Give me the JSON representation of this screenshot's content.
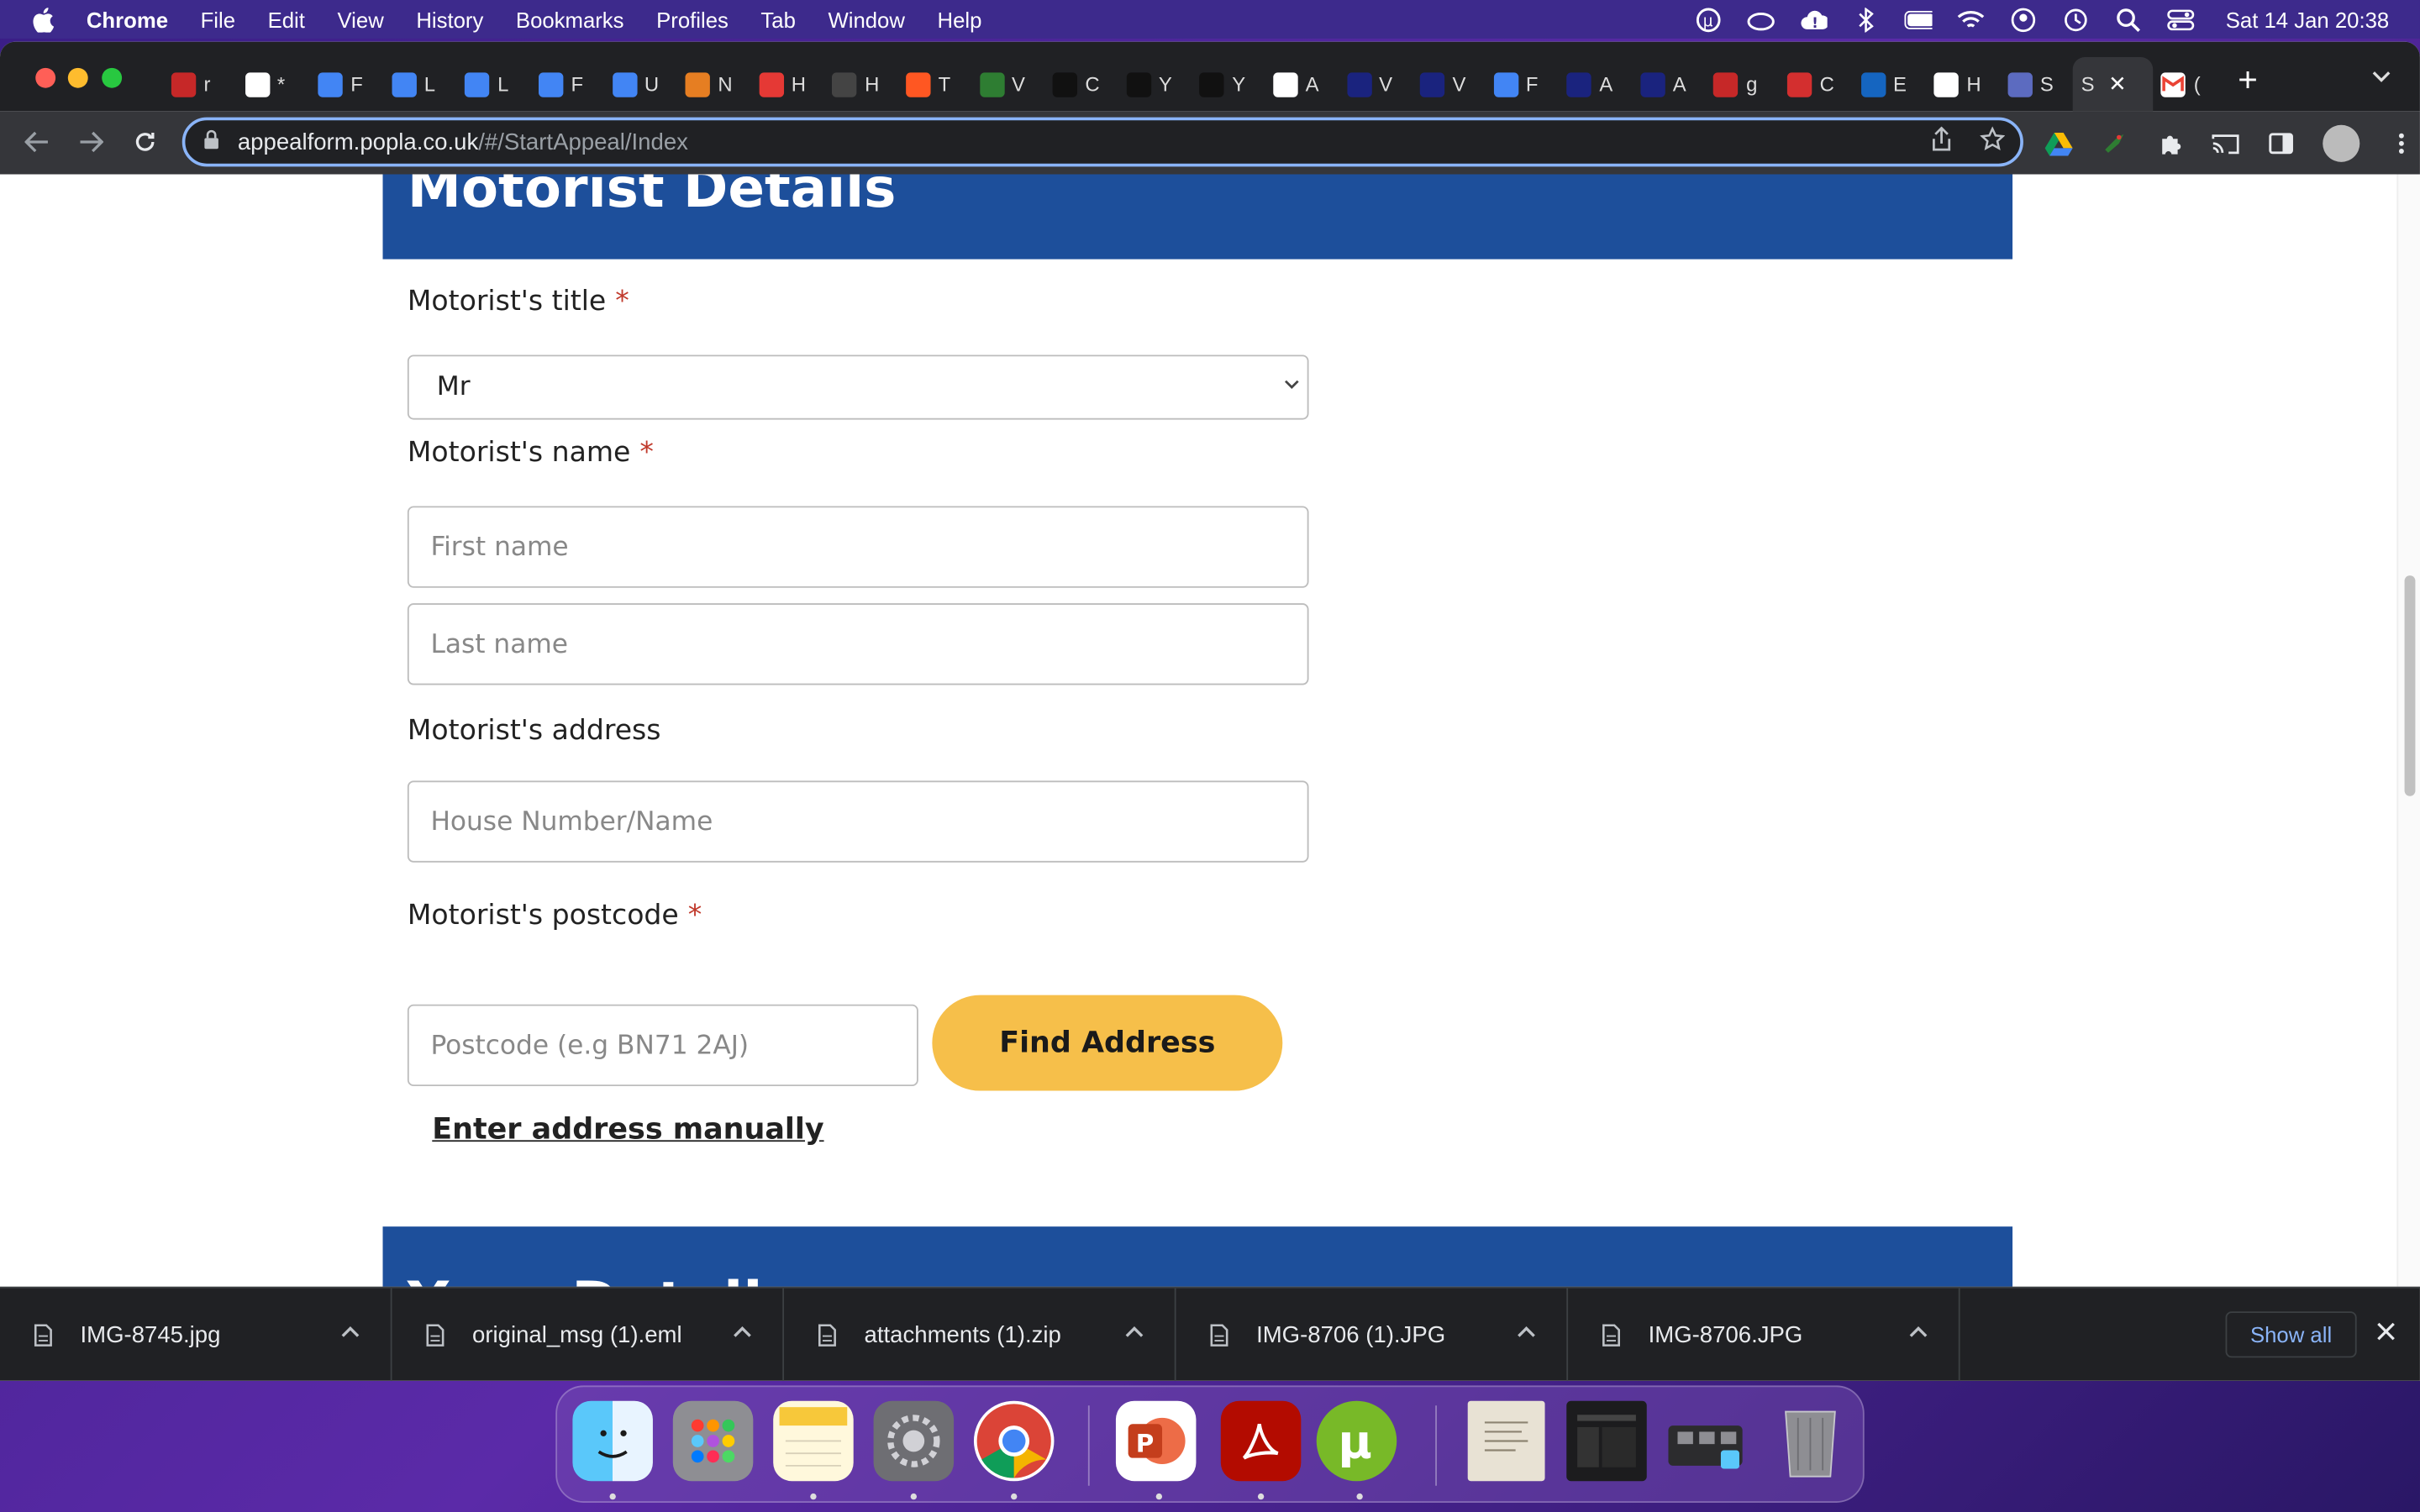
{
  "menubar": {
    "app_name": "Chrome",
    "menus": [
      "File",
      "Edit",
      "View",
      "History",
      "Bookmarks",
      "Profiles",
      "Tab",
      "Window",
      "Help"
    ],
    "clock": "Sat 14 Jan  20:38"
  },
  "browser": {
    "url_host": "appealform.popla.co.uk",
    "url_path": "/#/StartAppeal/Index",
    "active_tab_label": "S",
    "tabs": [
      {
        "icon": "pdf-icon",
        "label": "r",
        "color": "#c62828"
      },
      {
        "icon": "mse-icon",
        "label": "*",
        "color": "#ffffff"
      },
      {
        "icon": "docs-icon",
        "label": "F",
        "color": "#4285f4"
      },
      {
        "icon": "docs-icon",
        "label": "L",
        "color": "#4285f4"
      },
      {
        "icon": "docs-icon",
        "label": "L",
        "color": "#4285f4"
      },
      {
        "icon": "docs-icon",
        "label": "F",
        "color": "#4285f4"
      },
      {
        "icon": "docs-icon",
        "label": "U",
        "color": "#4285f4"
      },
      {
        "icon": "orange-square-icon",
        "label": "N",
        "color": "#e67e22"
      },
      {
        "icon": "red-circle-icon",
        "label": "H",
        "color": "#e53935"
      },
      {
        "icon": "crown-icon",
        "label": "H",
        "color": "#444444"
      },
      {
        "icon": "arrow-icon",
        "label": "T",
        "color": "#ff5722"
      },
      {
        "icon": "vc-icon",
        "label": "V",
        "color": "#2e7d32"
      },
      {
        "icon": "amazon-icon",
        "label": "C",
        "color": "#111111"
      },
      {
        "icon": "amazon-icon",
        "label": "Y",
        "color": "#111111"
      },
      {
        "icon": "amazon-icon",
        "label": "Y",
        "color": "#111111"
      },
      {
        "icon": "google-icon",
        "label": "A",
        "color": "#ffffff"
      },
      {
        "icon": "ico-icon",
        "label": "V",
        "color": "#1a237e"
      },
      {
        "icon": "ico-icon",
        "label": "V",
        "color": "#1a237e"
      },
      {
        "icon": "docs-icon",
        "label": "F",
        "color": "#4285f4"
      },
      {
        "icon": "ico-icon",
        "label": "A",
        "color": "#1a237e"
      },
      {
        "icon": "ico-icon",
        "label": "A",
        "color": "#1a237e"
      },
      {
        "icon": "pdf-icon",
        "label": "g",
        "color": "#c62828"
      },
      {
        "icon": "red-blocks-icon",
        "label": "C",
        "color": "#d32f2f"
      },
      {
        "icon": "wave-icon",
        "label": "E",
        "color": "#1565c0"
      },
      {
        "icon": "google-icon",
        "label": "H",
        "color": "#ffffff"
      },
      {
        "icon": "globe-icon",
        "label": "S",
        "color": "#5c6bc0"
      }
    ],
    "last_tab": {
      "icon": "gmail-icon",
      "label": "("
    }
  },
  "page": {
    "section_top_title": "Motorist Details",
    "title_label": "Motorist's title",
    "title_value": "Mr",
    "name_label": "Motorist's name",
    "first_name_placeholder": "First name",
    "last_name_placeholder": "Last name",
    "address_label": "Motorist's address",
    "house_placeholder": "House Number/Name",
    "postcode_label": "Motorist's postcode",
    "postcode_placeholder": "Postcode (e.g BN71 2AJ)",
    "find_address_label": "Find Address",
    "manual_link_label": "Enter address manually",
    "section_bottom_title": "Your Details",
    "required_marker": "*"
  },
  "downloads": {
    "items": [
      "IMG-8745.jpg",
      "original_msg (1).eml",
      "attachments (1).zip",
      "IMG-8706 (1).JPG",
      "IMG-8706.JPG"
    ],
    "show_all_label": "Show all"
  },
  "dock": {
    "apps": [
      "finder-icon",
      "launchpad-icon",
      "notes-icon",
      "system-settings-icon",
      "chrome-icon",
      "powerpoint-icon",
      "acrobat-icon",
      "utorrent-icon",
      "document-thumbnail",
      "screenshot-thumbnail",
      "folder-stack",
      "trash-icon"
    ]
  }
}
